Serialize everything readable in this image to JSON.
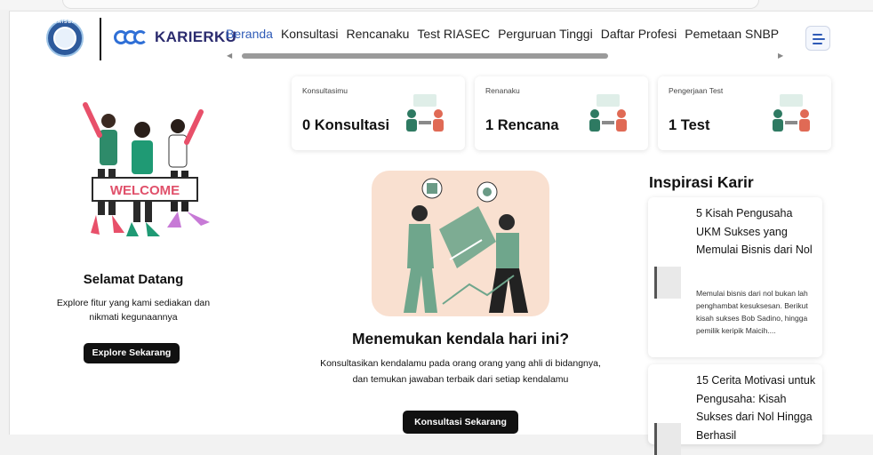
{
  "header": {
    "badge_text": "UNISBA",
    "brand_name": "KARIERKU",
    "nav": [
      {
        "label": "Beranda",
        "active": true
      },
      {
        "label": "Konsultasi",
        "active": false
      },
      {
        "label": "Rencanaku",
        "active": false
      },
      {
        "label": "Test RIASEC",
        "active": false
      },
      {
        "label": "Perguruan Tinggi",
        "active": false
      },
      {
        "label": "Daftar Profesi",
        "active": false
      },
      {
        "label": "Pemetaan SNBP",
        "active": false
      }
    ],
    "accent_color": "#2f5bb7"
  },
  "welcome": {
    "banner_text": "WELCOME",
    "title": "Selamat Datang",
    "description": "Explore fitur yang kami sediakan dan nikmati kegunaannya",
    "button_label": "Explore Sekarang"
  },
  "stats": [
    {
      "label": "Konsultasimu",
      "value": "0 Konsultasi"
    },
    {
      "label": "Renanaku",
      "value": "1 Rencana"
    },
    {
      "label": "Pengerjaan Test",
      "value": "1 Test"
    }
  ],
  "center": {
    "title": "Menemukan kendala hari ini?",
    "description": "Konsultasikan kendalamu pada orang orang yang ahli di bidangnya, dan temukan jawaban terbaik dari setiap kendalamu",
    "button_label": "Konsultasi Sekarang"
  },
  "inspirasi": {
    "title": "Inspirasi Karir",
    "articles": [
      {
        "title": "5 Kisah Pengusaha UKM Sukses yang Memulai Bisnis dari Nol",
        "excerpt": "Memulai bisnis dari nol bukan lah penghambat kesuksesan. Berikut kisah sukses Bob Sadino, hingga pemilik keripik Maicih...."
      },
      {
        "title": "15 Cerita Motivasi untuk Pengusaha: Kisah Sukses dari Nol Hingga Berhasil",
        "excerpt": ""
      }
    ]
  }
}
